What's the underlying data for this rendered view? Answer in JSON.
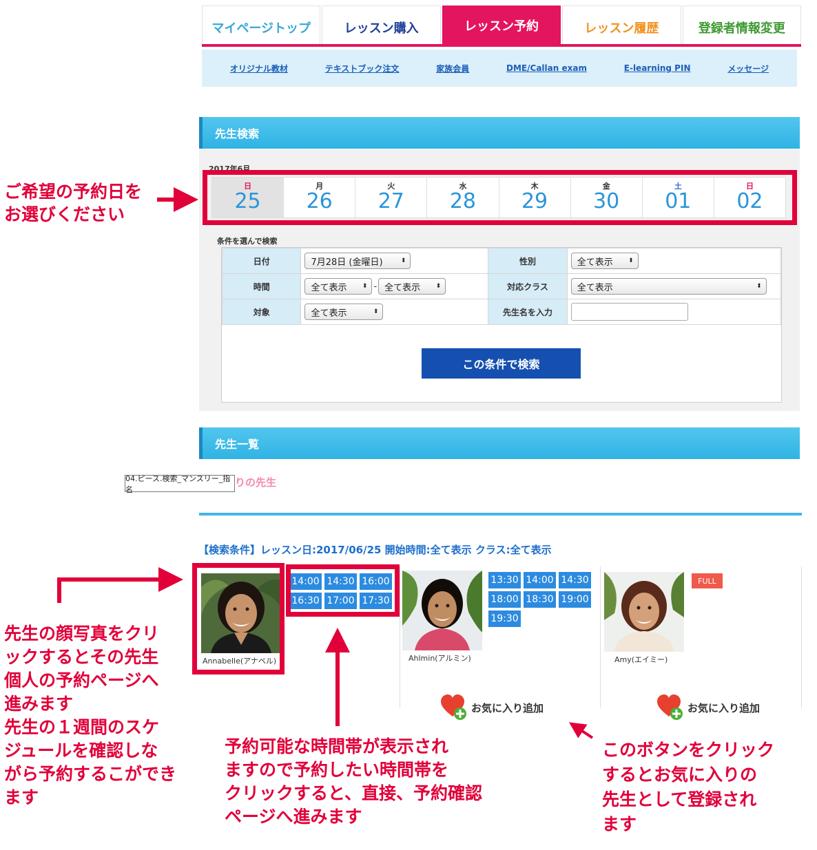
{
  "nav": {
    "tabs": [
      {
        "label": "マイページトップ"
      },
      {
        "label": "レッスン購入"
      },
      {
        "label": "レッスン予約",
        "active": true
      },
      {
        "label": "レッスン履歴"
      },
      {
        "label": "登録者情報変更"
      }
    ]
  },
  "subnav": {
    "links": [
      {
        "label": "オリジナル教材"
      },
      {
        "label": "テキストブック注文"
      },
      {
        "label": "家族会員"
      },
      {
        "label": "DME/Callan exam"
      },
      {
        "label": "E-learning PIN"
      },
      {
        "label": "メッセージ"
      }
    ]
  },
  "search": {
    "header": "先生検索",
    "month": "2017年6月",
    "days": [
      {
        "dow": "日",
        "date": "25",
        "selected": true
      },
      {
        "dow": "月",
        "date": "26"
      },
      {
        "dow": "火",
        "date": "27"
      },
      {
        "dow": "水",
        "date": "28"
      },
      {
        "dow": "木",
        "date": "29"
      },
      {
        "dow": "金",
        "date": "30"
      },
      {
        "dow": "土",
        "date": "01"
      },
      {
        "dow": "日",
        "date": "02"
      }
    ],
    "conditions_label": "条件を選んで検索",
    "fields": {
      "date_label": "日付",
      "date_value": "7月28日 (金曜日)",
      "gender_label": "性別",
      "gender_value": "全て表示",
      "time_label": "時間",
      "time_from": "全て表示",
      "time_to": "全て表示",
      "time_separator": "-",
      "class_label": "対応クラス",
      "class_value": "全て表示",
      "target_label": "対象",
      "target_value": "全て表示",
      "name_label": "先生名を入力",
      "name_value": ""
    },
    "button": "この条件で検索"
  },
  "teacher_list": {
    "header": "先生一覧",
    "tooltip": "04.ピース.検索_マンスリー_指名",
    "favorites_label": "りの先生",
    "criteria": "【検索条件】レッスン日:2017/06/25 開始時間:全て表示 クラス:全て表示",
    "teachers": [
      {
        "name": "Annabelle(アナベル)",
        "slots": [
          "14:00",
          "14:30",
          "16:00",
          "16:30",
          "17:00",
          "17:30"
        ]
      },
      {
        "name": "Ahlmin(アルミン)",
        "slots": [
          "13:30",
          "14:00",
          "14:30",
          "18:00",
          "18:30",
          "19:00",
          "19:30"
        ],
        "favorite": "お気に入り追加"
      },
      {
        "name": "Amy(エイミー)",
        "badge": "FULL",
        "favorite": "お気に入り追加"
      }
    ]
  },
  "annotations": {
    "select_date": "ご希望の予約日を\nお選びください",
    "photo_click": "先生の顔写真をクリ\nックするとその先生\n個人の予約ページへ\n進みます\n先生の１週間のスケ\nジュールを確認しな\nがら予約するこができ\nます",
    "slots_click": "予約可能な時間帯が表示され\nますので予約したい時間帯を\nクリックすると、直接、予約確認\nページへ進みます",
    "fav_click": "このボタンをクリック\nするとお気に入りの\n先生として登録され\nます"
  },
  "colors": {
    "accent_pink": "#e3155f",
    "header_blue": "#2fb3e4",
    "slot_blue": "#2c8be0",
    "annotation_red": "#e1003a",
    "button_blue": "#1550b0"
  }
}
